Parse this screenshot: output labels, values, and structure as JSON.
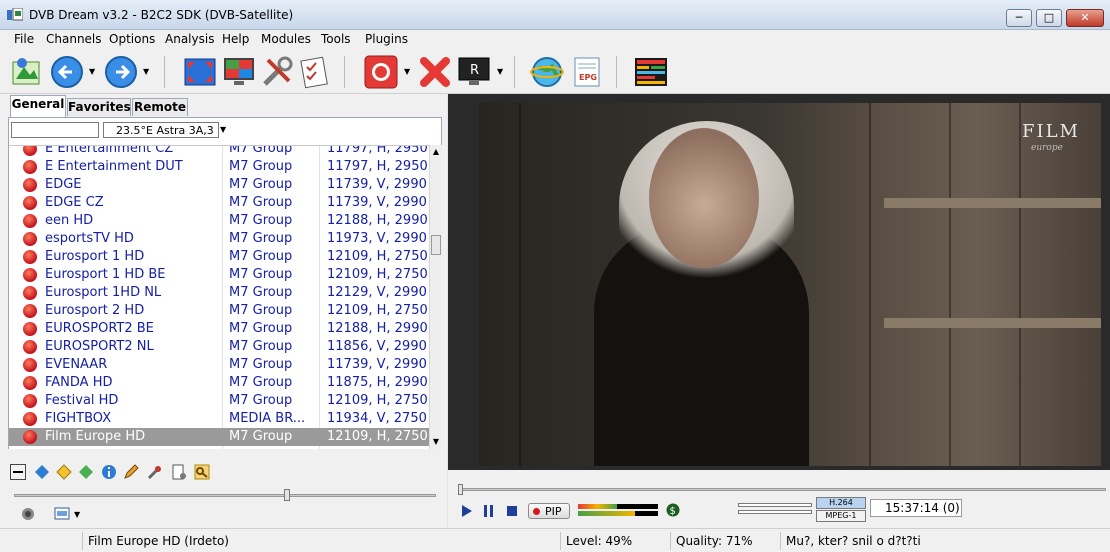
{
  "window": {
    "title": "DVB Dream v3.2 - B2C2 SDK (DVB-Satellite)",
    "minimize": "─",
    "maximize": "□",
    "close": "✕"
  },
  "menu": [
    "File",
    "Channels",
    "Options",
    "Analysis",
    "Help",
    "Modules",
    "Tools",
    "Plugins"
  ],
  "toolbar": {
    "icons": [
      "channel-list-icon",
      "back-icon",
      "forward-icon",
      "fullscreen-icon",
      "monitor-icon",
      "tools-icon",
      "checklist-icon",
      "record-icon",
      "delete-icon",
      "screen-record-icon",
      "globe-icon",
      "epg-icon",
      "teletext-icon"
    ],
    "epg_label": "EPG",
    "record_box_label": "R"
  },
  "tabs": [
    "General",
    "Favorites",
    "Remote"
  ],
  "filter": {
    "search_value": "",
    "satellite": "23.5°E Astra 3A,3"
  },
  "channels": [
    {
      "name": "E Entertainment CZ",
      "provider": "M7 Group",
      "freq": "11797, H, 2950"
    },
    {
      "name": "E Entertainment DUT",
      "provider": "M7 Group",
      "freq": "11797, H, 2950"
    },
    {
      "name": "EDGE",
      "provider": "M7 Group",
      "freq": "11739, V, 2990"
    },
    {
      "name": "EDGE CZ",
      "provider": "M7 Group",
      "freq": "11739, V, 2990"
    },
    {
      "name": "een HD",
      "provider": "M7 Group",
      "freq": "12188, H, 2990"
    },
    {
      "name": "esportsTV HD",
      "provider": "M7 Group",
      "freq": "11973, V, 2990"
    },
    {
      "name": "Eurosport 1 HD",
      "provider": "M7 Group",
      "freq": "12109, H, 2750"
    },
    {
      "name": "Eurosport 1 HD BE",
      "provider": "M7 Group",
      "freq": "12109, H, 2750"
    },
    {
      "name": "Eurosport 1HD NL",
      "provider": "M7 Group",
      "freq": "12129, V, 2990"
    },
    {
      "name": "Eurosport 2 HD",
      "provider": "M7 Group",
      "freq": "12109, H, 2750"
    },
    {
      "name": "EUROSPORT2 BE",
      "provider": "M7 Group",
      "freq": "12188, H, 2990"
    },
    {
      "name": "EUROSPORT2 NL",
      "provider": "M7 Group",
      "freq": "11856, V, 2990"
    },
    {
      "name": "EVENAAR",
      "provider": "M7 Group",
      "freq": "11739, V, 2990"
    },
    {
      "name": "FANDA HD",
      "provider": "M7 Group",
      "freq": "11875, H, 2990"
    },
    {
      "name": "Festival HD",
      "provider": "M7 Group",
      "freq": "12109, H, 2750"
    },
    {
      "name": "FIGHTBOX",
      "provider": "MEDIA BR...",
      "freq": "11934, V, 2750"
    },
    {
      "name": "Film Europe HD",
      "provider": "M7 Group",
      "freq": "12109, H, 2750",
      "selected": true
    }
  ],
  "video": {
    "logo": "FILM",
    "logo_sub": "europe"
  },
  "player": {
    "pip_label": "PIP",
    "codec_video": "H.264",
    "codec_audio": "MPEG-1",
    "time": "15:37:14  (0)"
  },
  "status": {
    "channel": "Film Europe HD (Irdeto)",
    "level": "Level: 49%",
    "quality": "Quality: 71%",
    "program": "Mu?, kter? snil o d?t?ti"
  },
  "colors": {
    "channel_text": "#1520a6",
    "selected_row": "#9a9a9a",
    "record_red": "#d4171e"
  }
}
